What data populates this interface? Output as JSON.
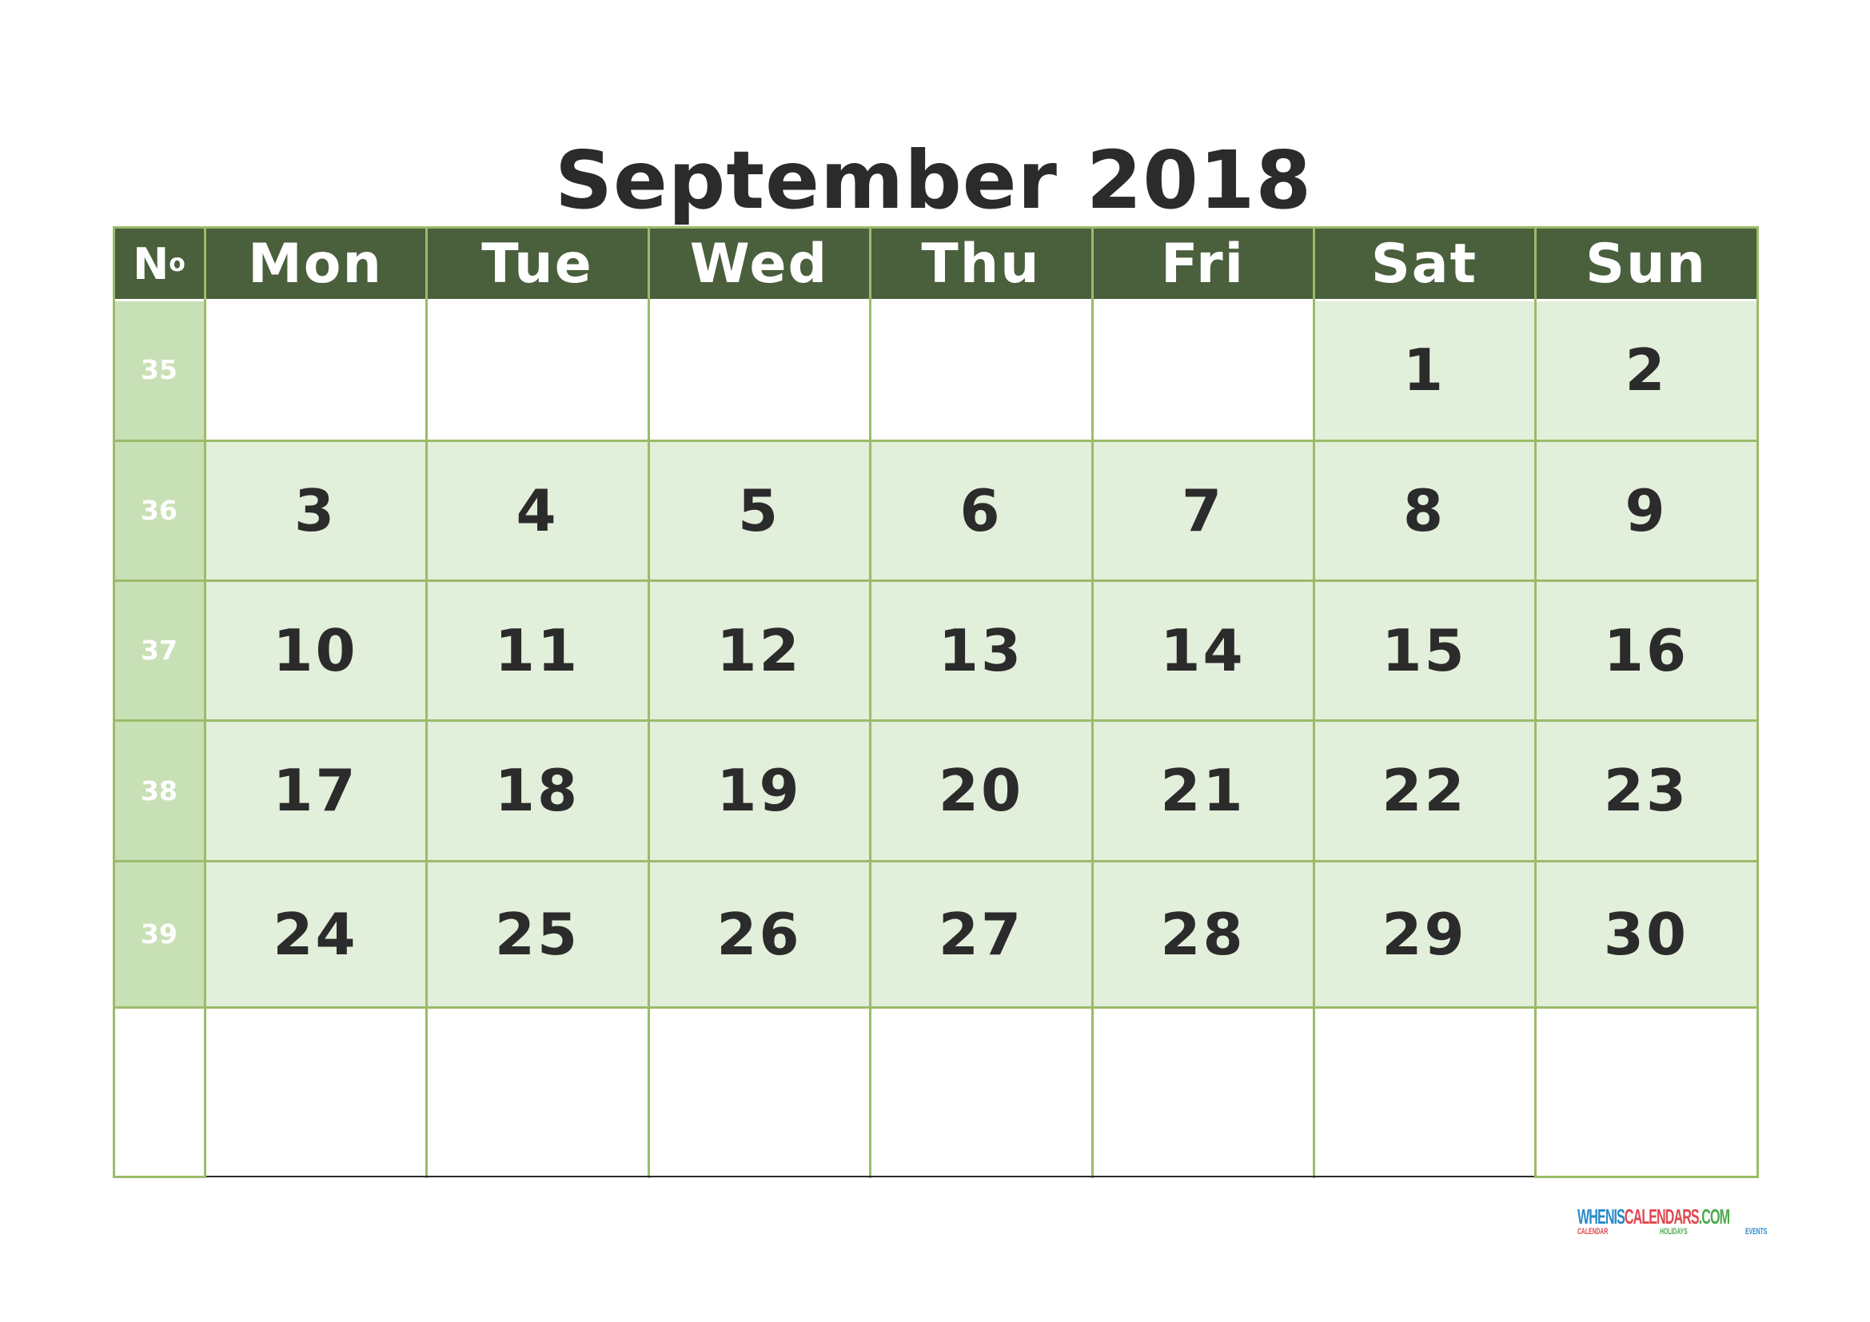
{
  "calendar": {
    "title": "September 2018",
    "month": "September",
    "year": 2018,
    "week_column_label": "N",
    "week_column_label_sup": "o",
    "weekday_headers": [
      "Mon",
      "Tue",
      "Wed",
      "Thu",
      "Fri",
      "Sat",
      "Sun"
    ],
    "weeks": [
      {
        "week_number": "35",
        "days": [
          "",
          "",
          "",
          "",
          "",
          "1",
          "2"
        ]
      },
      {
        "week_number": "36",
        "days": [
          "3",
          "4",
          "5",
          "6",
          "7",
          "8",
          "9"
        ]
      },
      {
        "week_number": "37",
        "days": [
          "10",
          "11",
          "12",
          "13",
          "14",
          "15",
          "16"
        ]
      },
      {
        "week_number": "38",
        "days": [
          "17",
          "18",
          "19",
          "20",
          "21",
          "22",
          "23"
        ]
      },
      {
        "week_number": "39",
        "days": [
          "24",
          "25",
          "26",
          "27",
          "28",
          "29",
          "30"
        ]
      },
      {
        "week_number": "",
        "days": [
          "",
          "",
          "",
          "",
          "",
          "",
          ""
        ]
      }
    ]
  },
  "colors": {
    "header_bg": "#4a5f3c",
    "week_col_bg": "#c8e0b5",
    "day_filled_bg": "#e2efda",
    "border": "#9bbb6a",
    "text_dark": "#2b2b2b"
  },
  "logo": {
    "part1": "WHENIS",
    "part2": "CALENDARS",
    "part3": ".COM",
    "sub1": "CALENDAR",
    "sub2": "HOLIDAYS",
    "sub3": "EVENTS",
    "color1": "#2a8ac8",
    "color2": "#e0484f",
    "color3": "#4aaa4a"
  }
}
